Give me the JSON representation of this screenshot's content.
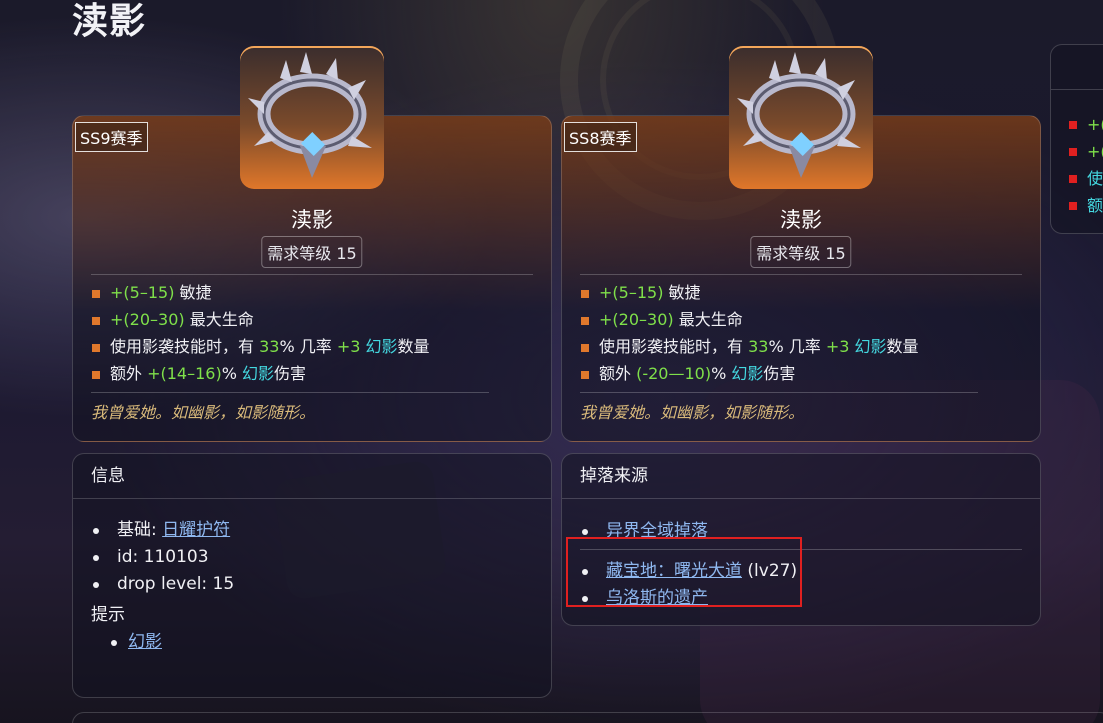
{
  "page": {
    "title": "渎影"
  },
  "item_cards": [
    {
      "season": "SS9赛季",
      "name": "渎影",
      "required_level": "需求等级 15",
      "stats": [
        {
          "segments": [
            {
              "text": "+(5–15)",
              "style": "green"
            },
            {
              "text": " 敏捷",
              "style": "normal"
            }
          ]
        },
        {
          "segments": [
            {
              "text": "+(20–30)",
              "style": "green"
            },
            {
              "text": " 最大生命",
              "style": "normal"
            }
          ]
        },
        {
          "segments": [
            {
              "text": "使用影袭技能时，有 ",
              "style": "normal"
            },
            {
              "text": "33",
              "style": "green"
            },
            {
              "text": "% 几率 ",
              "style": "normal"
            },
            {
              "text": "+3",
              "style": "green"
            },
            {
              "text": " 幻影",
              "style": "cyan"
            },
            {
              "text": "数量",
              "style": "normal"
            }
          ]
        },
        {
          "segments": [
            {
              "text": "额外 ",
              "style": "normal"
            },
            {
              "text": "+(14–16)",
              "style": "green"
            },
            {
              "text": "% ",
              "style": "normal"
            },
            {
              "text": "幻影",
              "style": "cyan"
            },
            {
              "text": "伤害",
              "style": "normal"
            }
          ]
        }
      ],
      "flavor": "我曾爱她。如幽影，如影随形。"
    },
    {
      "season": "SS8赛季",
      "name": "渎影",
      "required_level": "需求等级 15",
      "stats": [
        {
          "segments": [
            {
              "text": "+(5–15)",
              "style": "green"
            },
            {
              "text": " 敏捷",
              "style": "normal"
            }
          ]
        },
        {
          "segments": [
            {
              "text": "+(20–30)",
              "style": "green"
            },
            {
              "text": " 最大生命",
              "style": "normal"
            }
          ]
        },
        {
          "segments": [
            {
              "text": "使用影袭技能时，有 ",
              "style": "normal"
            },
            {
              "text": "33",
              "style": "green"
            },
            {
              "text": "% 几率 ",
              "style": "normal"
            },
            {
              "text": "+3",
              "style": "green"
            },
            {
              "text": " 幻影",
              "style": "cyan"
            },
            {
              "text": "数量",
              "style": "normal"
            }
          ]
        },
        {
          "segments": [
            {
              "text": "额外 ",
              "style": "normal"
            },
            {
              "text": "(-20—10)",
              "style": "green"
            },
            {
              "text": "% ",
              "style": "normal"
            },
            {
              "text": "幻影",
              "style": "cyan"
            },
            {
              "text": "伤害",
              "style": "normal"
            }
          ]
        }
      ],
      "flavor": "我曾爱她。如幽影，如影随形。"
    }
  ],
  "info": {
    "header": "信息",
    "base_label": "基础: ",
    "base_link": "日耀护符",
    "id": "id: 110103",
    "drop_level": "drop level: 15",
    "hint_title": "提示",
    "hint_link": "幻影"
  },
  "drops": {
    "header": "掉落来源",
    "global": "异界全域掉落",
    "treasure_link": "藏宝地：曙光大道",
    "treasure_suffix": " (lv27)",
    "legacy_link": "乌洛斯的遗产"
  },
  "partial_card": {
    "items": [
      {
        "text": "+(",
        "style": "green"
      },
      {
        "text": "+(",
        "style": "green"
      },
      {
        "text": "使",
        "style": "cyan"
      },
      {
        "text": "额",
        "style": "cyan"
      }
    ]
  },
  "colors": {
    "stat_green": "#7fe04a",
    "stat_cyan": "#44d8e0",
    "bullet_orange": "#e0782c",
    "flavor_gold": "#d8b97a",
    "link_blue": "#8fb8f0",
    "highlight_red": "#e02020"
  },
  "icons": {
    "item": "spiked-ring-amulet-icon"
  }
}
